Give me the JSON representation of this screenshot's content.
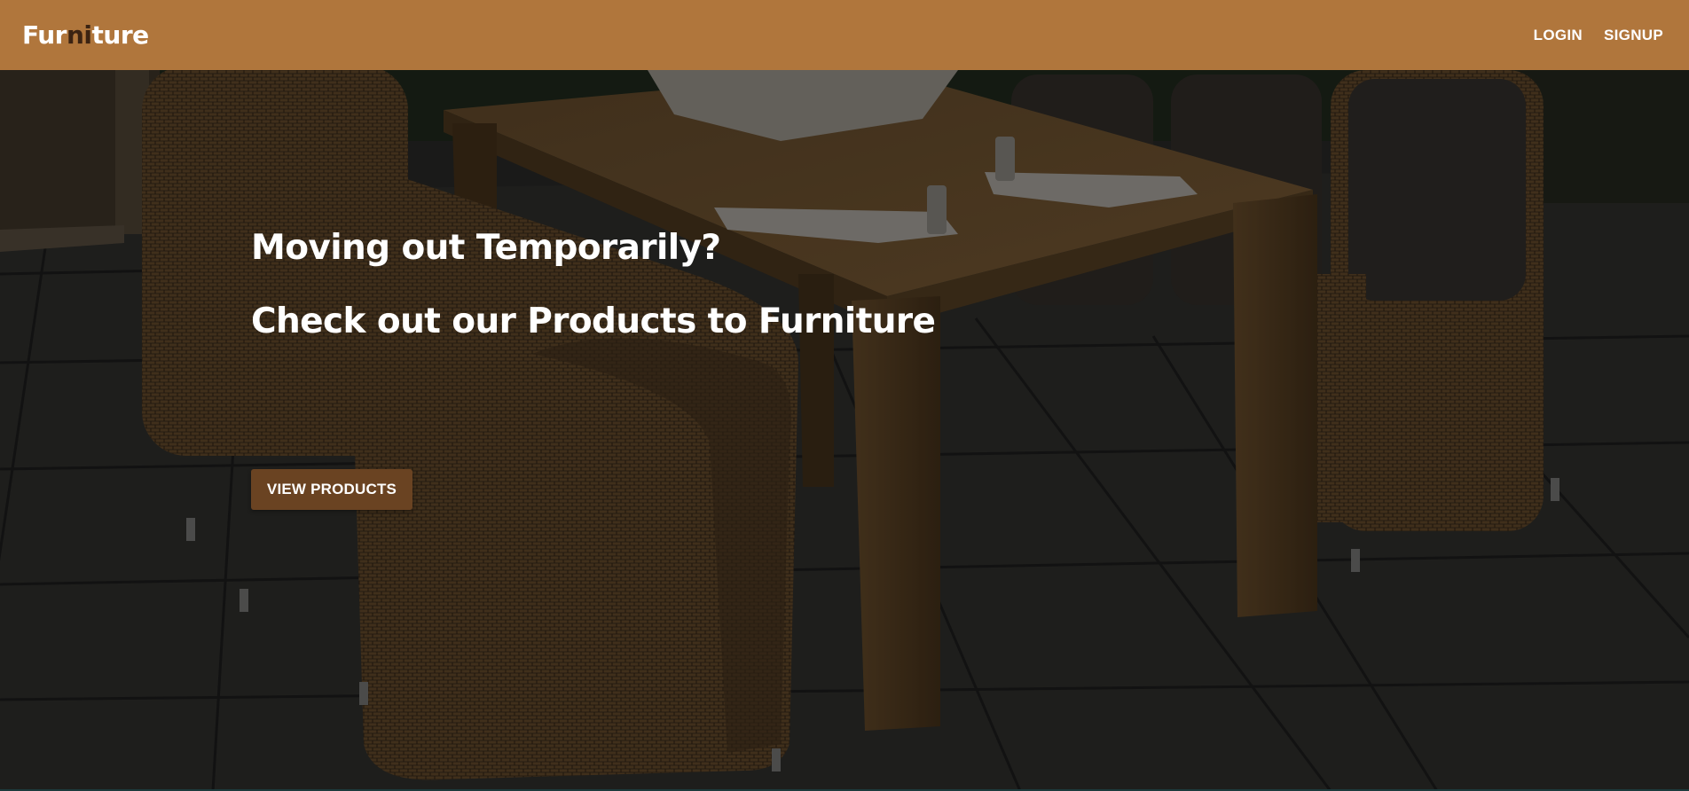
{
  "brand": {
    "part1": "Fur",
    "part2": "ni",
    "part3": "ture"
  },
  "nav": {
    "login": "LOGIN",
    "signup": "SIGNUP"
  },
  "hero": {
    "line1": "Moving out Temporarily?",
    "line2": "Check out our Products to Furniture",
    "button_label": "VIEW PRODUCTS"
  },
  "colors": {
    "navbar": "#b0763c",
    "brand_accent": "#3b2312",
    "button": "#6a4322",
    "text": "#ffffff"
  }
}
